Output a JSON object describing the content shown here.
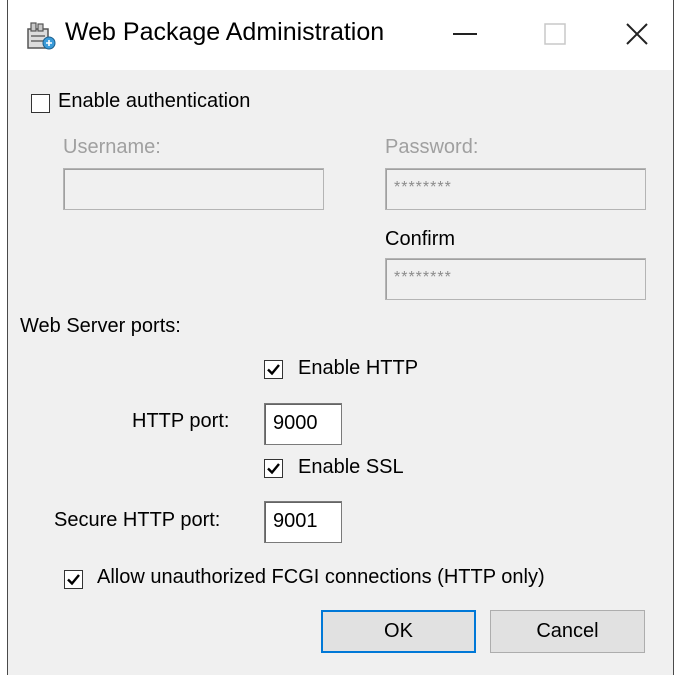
{
  "window": {
    "title": "Web Package Administration",
    "icon": "package-admin-icon"
  },
  "auth": {
    "enable_label": "Enable authentication",
    "enabled": false,
    "username_label": "Username:",
    "username_value": "",
    "password_label": "Password:",
    "password_value": "********",
    "confirm_label": "Confirm",
    "confirm_value": "********"
  },
  "ports": {
    "section_label": "Web Server ports:",
    "enable_http_label": "Enable HTTP",
    "enable_http_checked": true,
    "http_port_label": "HTTP port:",
    "http_port_value": "9000",
    "enable_ssl_label": "Enable SSL",
    "enable_ssl_checked": true,
    "secure_port_label": "Secure HTTP port:",
    "secure_port_value": "9001"
  },
  "fcgi": {
    "label": "Allow unauthorized FCGI connections (HTTP only)",
    "checked": true
  },
  "buttons": {
    "ok": "OK",
    "cancel": "Cancel"
  }
}
